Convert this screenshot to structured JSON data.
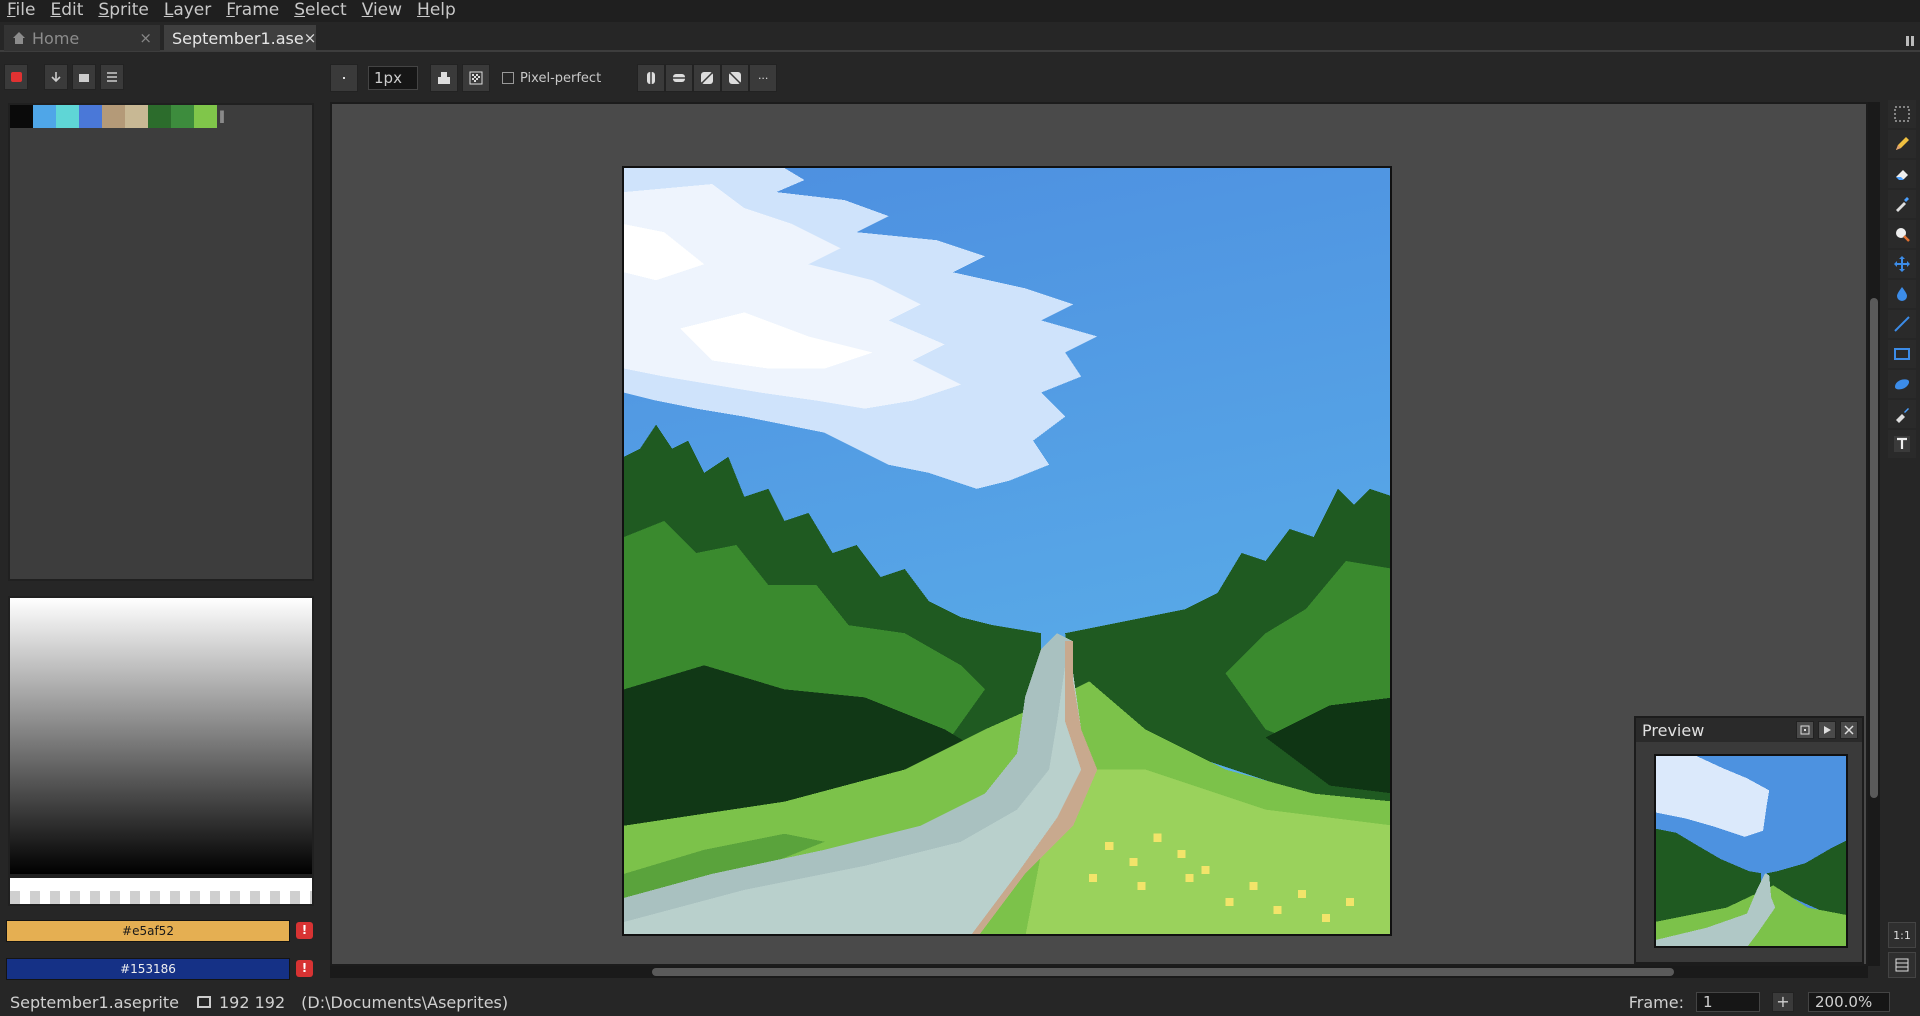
{
  "menu": [
    "File",
    "Edit",
    "Sprite",
    "Layer",
    "Frame",
    "Select",
    "View",
    "Help"
  ],
  "tabs": {
    "home": "Home",
    "file": "September1.ase",
    "close": "×"
  },
  "palette": {
    "swatches": [
      "#0a0a0a",
      "#4fa6e8",
      "#5fd6d6",
      "#4a78d8",
      "#b49a78",
      "#c8b894",
      "#2c6c2c",
      "#3d8c3d",
      "#80c64a"
    ],
    "more": "‖"
  },
  "context_bar": {
    "brush_size": "1px",
    "pixel_perfect_label": "Pixel-perfect",
    "more": "···"
  },
  "colors": {
    "foreground": "#e5af52",
    "background": "#153186",
    "warn": "!"
  },
  "preview": {
    "title": "Preview"
  },
  "tools": [
    "marquee-icon",
    "pencil-icon",
    "eraser-icon",
    "eyedropper-icon",
    "zoom-icon",
    "move-icon",
    "paint-bucket-icon",
    "line-icon",
    "rectangle-icon",
    "blob-icon",
    "spray-icon",
    "text-icon"
  ],
  "tool_bottom": {
    "one_to_one": "1:1"
  },
  "status": {
    "file": "September1.aseprite",
    "size": "192 192",
    "path": "(D:\\Documents\\Aseprites)",
    "frame_label": "Frame:",
    "frame_value": "1",
    "frame_add": "+",
    "zoom": "200.0%"
  }
}
